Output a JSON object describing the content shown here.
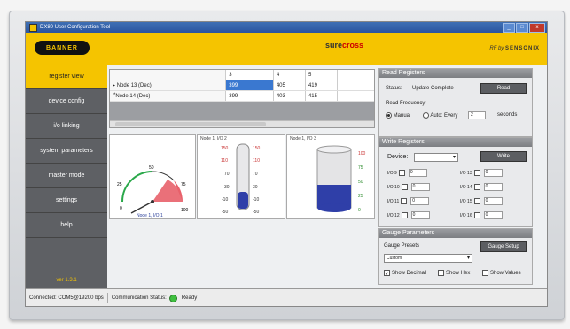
{
  "window": {
    "title": "DX80 User Configuration Tool",
    "btn_min": "_",
    "btn_max": "□",
    "btn_close": "x"
  },
  "header": {
    "brand": "BANNER",
    "product": "sure",
    "product2": "cross",
    "rfby": "RF by",
    "rfby2": "SENSONIX"
  },
  "sidebar": {
    "items": [
      {
        "label": "register view"
      },
      {
        "label": "device config"
      },
      {
        "label": "i/o linking"
      },
      {
        "label": "system parameters"
      },
      {
        "label": "master mode"
      },
      {
        "label": "settings"
      },
      {
        "label": "help"
      }
    ],
    "version": "ver 1.3.1"
  },
  "grid": {
    "columns": [
      "3",
      "4",
      "5"
    ],
    "rows": [
      {
        "name": "Node 13 (Dec)",
        "values": [
          "399",
          "405",
          "419"
        ]
      },
      {
        "name": "Node 14 (Dec)",
        "values": [
          "399",
          "403",
          "415"
        ]
      }
    ],
    "new_row_marker": "*"
  },
  "gauges": {
    "dial": {
      "title": "",
      "label": "Node 1, I/O 1",
      "ticks": [
        "0",
        "25",
        "50",
        "75",
        "100"
      ],
      "value": 65
    },
    "thermo": {
      "title": "Node 1, I/O 2",
      "ticks": [
        "150",
        "110",
        "70",
        "30",
        "-10",
        "-50"
      ],
      "value": -20
    },
    "tank": {
      "title": "Node 1, I/O 3",
      "ticks": [
        "100",
        "75",
        "50",
        "25",
        "0"
      ],
      "value": 40
    }
  },
  "read": {
    "title": "Read Registers",
    "status_label": "Status:",
    "status_value": "Update Complete",
    "read_btn": "Read",
    "freq_label": "Read Frequency",
    "manual": "Manual",
    "auto": "Auto: Every",
    "seconds_value": "2",
    "seconds": "seconds"
  },
  "write": {
    "title": "Write Registers",
    "device_label": "Device:",
    "write_btn": "Write",
    "ios": [
      {
        "label": "I/O 9",
        "value": "0"
      },
      {
        "label": "I/O 13",
        "value": "0"
      },
      {
        "label": "I/O 10",
        "value": "0"
      },
      {
        "label": "I/O 14",
        "value": "0"
      },
      {
        "label": "I/O 11",
        "value": "0"
      },
      {
        "label": "I/O 15",
        "value": "0"
      },
      {
        "label": "I/O 12",
        "value": "0"
      },
      {
        "label": "I/O 16",
        "value": "0"
      }
    ]
  },
  "gaugeparams": {
    "title": "Gauge Parameters",
    "presets_label": "Gauge Presets",
    "preset_value": "Custom",
    "setup_btn": "Gauge Setup",
    "show_decimal": "Show Decimal",
    "show_hex": "Show Hex",
    "show_values": "Show Values"
  },
  "status": {
    "connected": "Connected: COM5@19200 bps",
    "comm_label": "Communication Status:",
    "comm_value": "Ready"
  },
  "colors": {
    "accent": "#f5c400",
    "sidebar": "#5e6064",
    "led": "#3fbf3f",
    "gauge_red": "#e8606a",
    "fluid": "#2f3fa8"
  }
}
